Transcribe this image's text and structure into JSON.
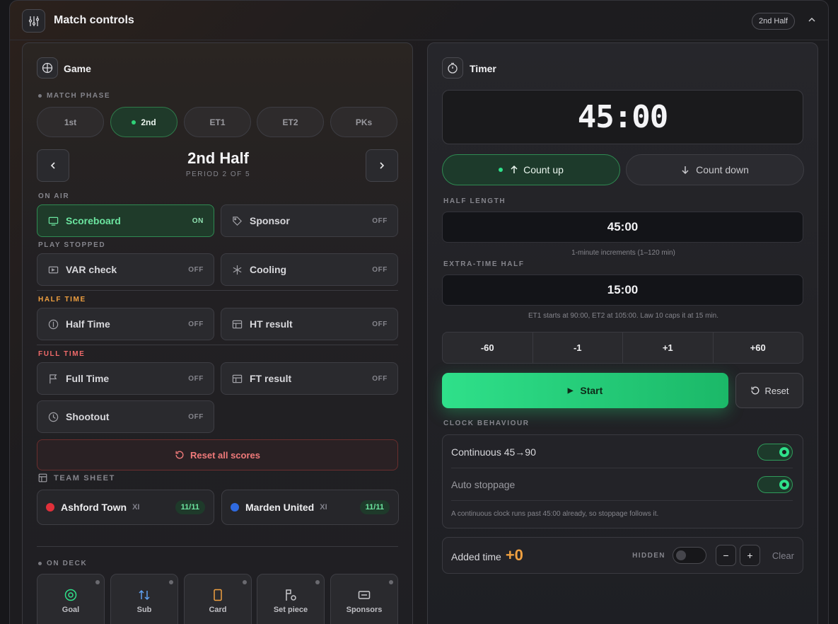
{
  "header": {
    "title": "Match controls",
    "badge": "2nd Half"
  },
  "game": {
    "title": "Game",
    "phase_label": "MATCH PHASE",
    "phases": [
      "1st",
      "2nd",
      "ET1",
      "ET2",
      "PKs"
    ],
    "active_phase": "2nd",
    "period_title": "2nd Half",
    "period_sub": "PERIOD 2 OF 5",
    "on_air_label": "ON AIR",
    "play_stopped_label": "PLAY STOPPED",
    "half_time_label": "HALF TIME",
    "full_time_label": "FULL TIME",
    "toggles": {
      "scoreboard": {
        "label": "Scoreboard",
        "state": "ON"
      },
      "sponsor": {
        "label": "Sponsor",
        "state": "OFF"
      },
      "var": {
        "label": "VAR check",
        "state": "OFF"
      },
      "cooling": {
        "label": "Cooling",
        "state": "OFF"
      },
      "halftime": {
        "label": "Half Time",
        "state": "OFF"
      },
      "htresult": {
        "label": "HT result",
        "state": "OFF"
      },
      "fulltime": {
        "label": "Full Time",
        "state": "OFF"
      },
      "ftresult": {
        "label": "FT result",
        "state": "OFF"
      },
      "shootout": {
        "label": "Shootout",
        "state": "OFF"
      }
    },
    "reset_all": "Reset all scores",
    "team_sheet_label": "TEAM SHEET",
    "teams": [
      {
        "name": "Ashford Town",
        "xi": "XI",
        "count": "11/11",
        "color": "#e0303a"
      },
      {
        "name": "Marden United",
        "xi": "XI",
        "count": "11/11",
        "color": "#2f6ae0"
      }
    ],
    "on_deck_label": "ON DECK",
    "deck": [
      "Goal",
      "Sub",
      "Card",
      "Set piece",
      "Sponsors"
    ]
  },
  "timer": {
    "title": "Timer",
    "clock": "45:00",
    "count_up": "Count up",
    "count_down": "Count down",
    "half_length_label": "HALF LENGTH",
    "half_length": "45:00",
    "half_hint": "1-minute increments (1–120 min)",
    "et_label": "EXTRA-TIME HALF",
    "et_length": "15:00",
    "et_hint": "ET1 starts at 90:00, ET2 at 105:00. Law 10 caps it at 15 min.",
    "adjust": [
      "-60",
      "-1",
      "+1",
      "+60"
    ],
    "start": "Start",
    "reset": "Reset",
    "behaviour_label": "CLOCK BEHAVIOUR",
    "continuous": "Continuous 45→90",
    "auto_stoppage": "Auto stoppage",
    "behaviour_note": "A continuous clock runs past 45:00 already, so stoppage follows it.",
    "added_label": "Added time",
    "added_value": "+0",
    "hidden_label": "HIDDEN",
    "minus": "−",
    "plus": "+",
    "clear": "Clear"
  },
  "colors": {
    "accent": "#2fe08a",
    "danger": "#f07a7a",
    "warning": "#f0a040"
  }
}
